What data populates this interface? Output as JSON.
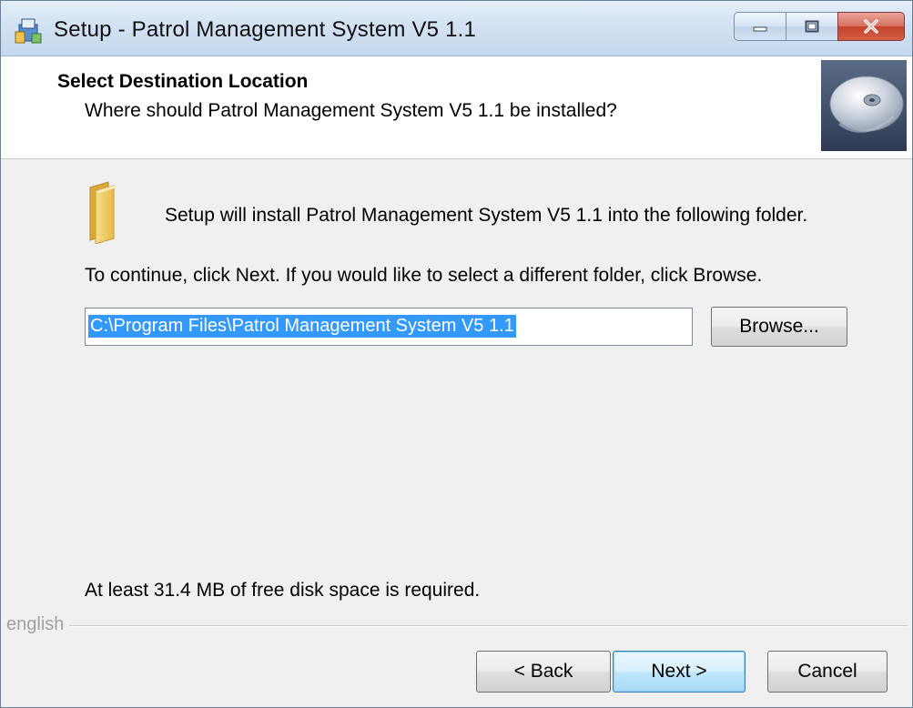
{
  "window": {
    "title": "Setup - Patrol Management System V5 1.1",
    "controls": {
      "minimize_icon": "minimize-icon",
      "maximize_icon": "maximize-icon",
      "close_icon": "close-icon"
    }
  },
  "header": {
    "title": "Select Destination Location",
    "subtitle": "Where should Patrol Management System V5 1.1 be installed?"
  },
  "body": {
    "intro": "Setup will install Patrol Management System V5 1.1 into the following folder.",
    "continue_hint": "To continue, click Next. If you would like to select a different folder, click Browse.",
    "path_value": "C:\\Program Files\\Patrol Management System V5 1.1",
    "browse_label": "Browse...",
    "disk_space": "At least 31.4 MB of free disk space is required."
  },
  "footer": {
    "language": "english",
    "back_label": "< Back",
    "next_label": "Next >",
    "cancel_label": "Cancel"
  },
  "colors": {
    "titlebar": "#d3e2f3",
    "selection": "#3399ff",
    "close_button": "#c4412b",
    "default_button_border": "#3c7fb1"
  }
}
